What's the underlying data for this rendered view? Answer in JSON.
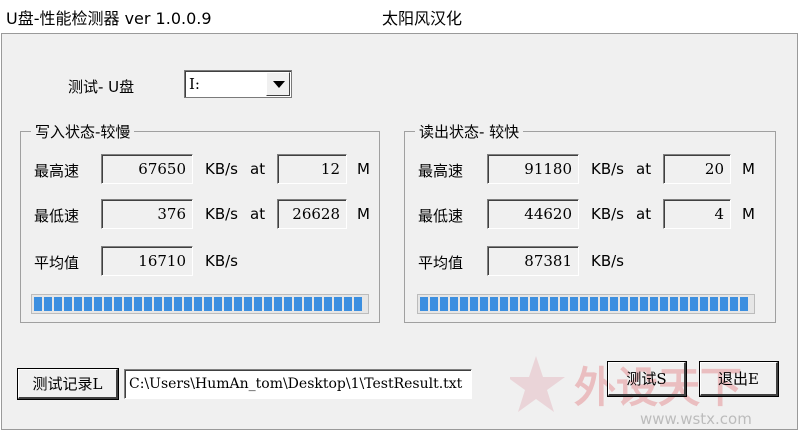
{
  "window": {
    "title": "U盘-性能检测器  ver 1.0.0.9",
    "credit": "太阳风汉化"
  },
  "test_drive": {
    "label": "测试- U盘",
    "selected": "I:"
  },
  "write": {
    "title": "写入状态-较慢",
    "max": {
      "label": "最高速",
      "value": "67650",
      "unit": "KB/s",
      "at": "at",
      "size": "12",
      "size_unit": "M"
    },
    "min": {
      "label": "最低速",
      "value": "376",
      "unit": "KB/s",
      "at": "at",
      "size": "26628",
      "size_unit": "M"
    },
    "avg": {
      "label": "平均值",
      "value": "16710",
      "unit": "KB/s"
    },
    "progress": 1.0
  },
  "read": {
    "title": "读出状态- 较快",
    "max": {
      "label": "最高速",
      "value": "91180",
      "unit": "KB/s",
      "at": "at",
      "size": "20",
      "size_unit": "M"
    },
    "min": {
      "label": "最低速",
      "value": "44620",
      "unit": "KB/s",
      "at": "at",
      "size": "4",
      "size_unit": "M"
    },
    "avg": {
      "label": "平均值",
      "value": "87381",
      "unit": "KB/s"
    },
    "progress": 1.0
  },
  "log": {
    "button_label": "测试记录L",
    "path": "C:\\Users\\HumAn_tom\\Desktop\\1\\TestResult.txt"
  },
  "buttons": {
    "test": "测试S",
    "exit": "退出E"
  },
  "watermark": {
    "text": "外设天下",
    "url": "www.wstx.com"
  },
  "colors": {
    "progress": "#3c8fe0",
    "watermark_red": "#d9322e"
  }
}
